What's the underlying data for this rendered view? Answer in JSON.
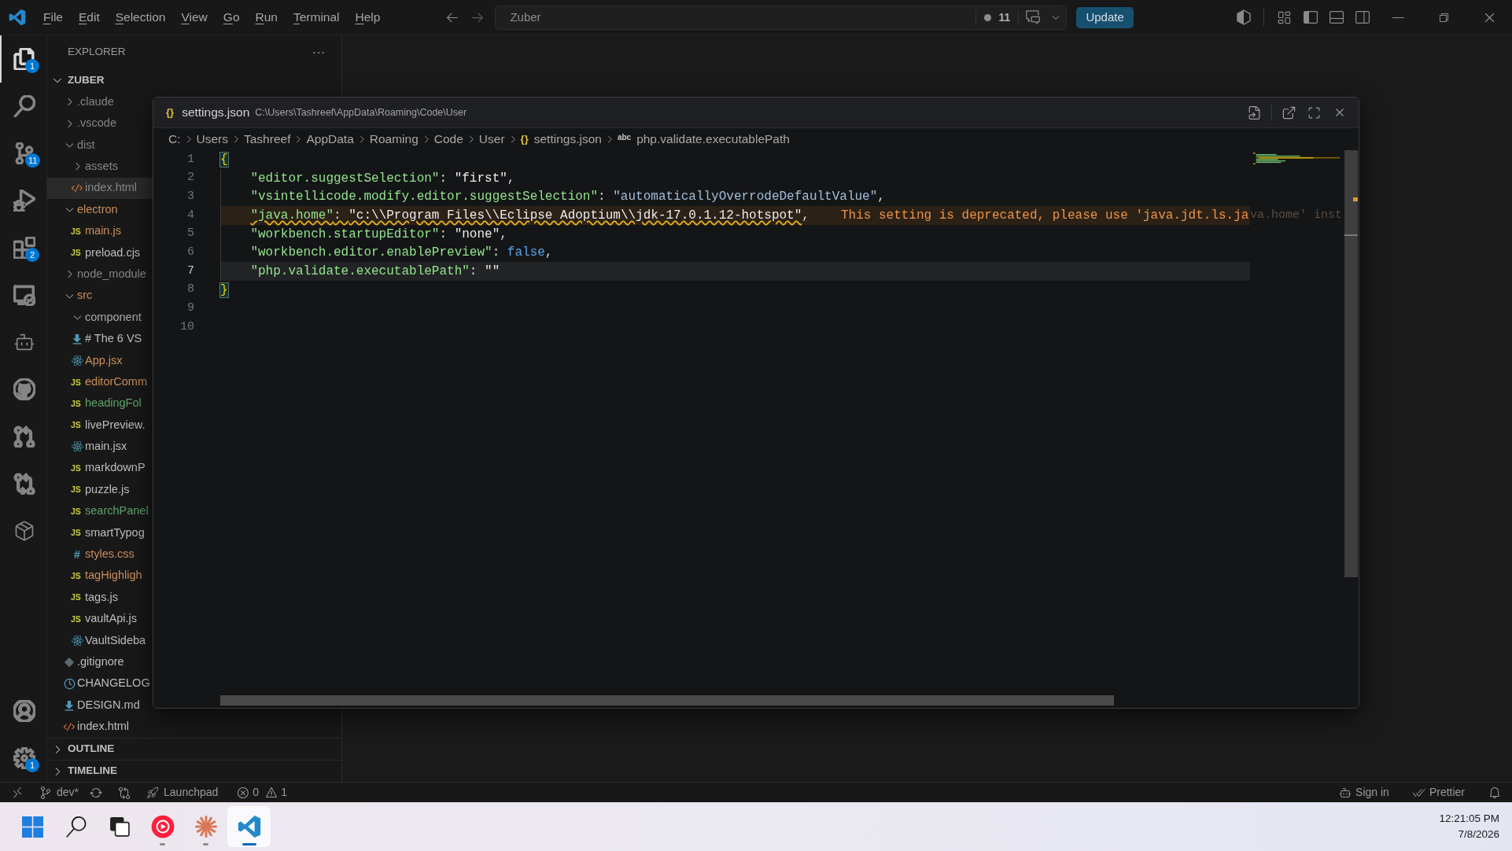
{
  "title_bar": {
    "menu": [
      {
        "label": "File"
      },
      {
        "label": "Edit"
      },
      {
        "label": "Selection"
      },
      {
        "label": "View"
      },
      {
        "label": "Go"
      },
      {
        "label": "Run"
      },
      {
        "label": "Terminal"
      },
      {
        "label": "Help"
      }
    ],
    "command_center": {
      "label": "Zuber",
      "count": "11"
    },
    "update_button": "Update",
    "layout_toggles": [
      {
        "kind": "primary_sidebar",
        "on": true
      },
      {
        "kind": "panel",
        "on": false
      },
      {
        "kind": "secondary_sidebar",
        "on": false
      }
    ]
  },
  "activity_bar": {
    "items": [
      {
        "kind": "explorer",
        "selected": true,
        "badge": "1"
      },
      {
        "kind": "search",
        "selected": false
      },
      {
        "kind": "source_control",
        "selected": false,
        "badge": "11"
      },
      {
        "kind": "run_debug",
        "selected": false
      },
      {
        "kind": "extensions",
        "selected": false,
        "badge": "2"
      },
      {
        "kind": "remote_explorer",
        "selected": false
      },
      {
        "kind": "copilot",
        "selected": false
      },
      {
        "kind": "github",
        "selected": false
      },
      {
        "kind": "pull_requests",
        "selected": false
      },
      {
        "kind": "compare",
        "selected": false
      },
      {
        "kind": "containers",
        "selected": false
      }
    ],
    "bottom": [
      {
        "kind": "accounts"
      },
      {
        "kind": "manage",
        "badge": "1"
      }
    ]
  },
  "sidebar": {
    "title": "EXPLORER",
    "root": {
      "label": "ZUBER",
      "expanded": true
    },
    "tree": [
      {
        "label": ".claude",
        "kind": "folder",
        "expanded": false,
        "selected": false,
        "color": "#858585"
      },
      {
        "label": ".vscode",
        "kind": "folder",
        "expanded": false,
        "selected": false,
        "color": "#858585"
      },
      {
        "label": "dist",
        "kind": "folder",
        "expanded": true,
        "selected": false,
        "color": "#858585",
        "children": [
          {
            "label": "assets",
            "kind": "folder",
            "expanded": false,
            "selected": false,
            "color": "#858585"
          },
          {
            "label": "index.html",
            "kind": "html",
            "selected": true,
            "color": "#858585"
          }
        ]
      },
      {
        "label": "electron",
        "kind": "folder",
        "expanded": true,
        "selected": false,
        "color": "#c98f59",
        "children": [
          {
            "label": "main.js",
            "kind": "js",
            "icon_text": "JS",
            "selected": false,
            "color": "#c98f59"
          },
          {
            "label": "preload.cjs",
            "kind": "js",
            "icon_text": "JS",
            "selected": false,
            "color": "#bdbdbd"
          }
        ]
      },
      {
        "label": "node_module",
        "kind": "folder",
        "expanded": false,
        "selected": false,
        "color": "#858585"
      },
      {
        "label": "src",
        "kind": "folder",
        "expanded": true,
        "selected": false,
        "color": "#c98f59",
        "children": [
          {
            "label": "component",
            "kind": "folder",
            "expanded": true,
            "selected": false,
            "color": "#a9a9a9"
          },
          {
            "label": "# The 6 VS",
            "kind": "markdown",
            "selected": false,
            "color": "#bdbdbd"
          },
          {
            "label": "App.jsx",
            "kind": "react",
            "selected": false,
            "color": "#c98f59"
          },
          {
            "label": "editorComm",
            "kind": "js",
            "icon_text": "JS",
            "selected": false,
            "color": "#c98f59"
          },
          {
            "label": "headingFol",
            "kind": "js",
            "icon_text": "JS",
            "selected": false,
            "color": "#5da36a"
          },
          {
            "label": "livePreview.",
            "kind": "js",
            "icon_text": "JS",
            "selected": false,
            "color": "#bdbdbd"
          },
          {
            "label": "main.jsx",
            "kind": "react",
            "selected": false,
            "color": "#bdbdbd"
          },
          {
            "label": "markdownP",
            "kind": "js",
            "icon_text": "JS",
            "selected": false,
            "color": "#bdbdbd"
          },
          {
            "label": "puzzle.js",
            "kind": "js",
            "icon_text": "JS",
            "selected": false,
            "color": "#bdbdbd"
          },
          {
            "label": "searchPanel",
            "kind": "js",
            "icon_text": "JS",
            "selected": false,
            "color": "#5da36a"
          },
          {
            "label": "smartTypog",
            "kind": "js",
            "icon_text": "JS",
            "selected": false,
            "color": "#bdbdbd"
          },
          {
            "label": "styles.css",
            "kind": "css",
            "icon_text": "#",
            "selected": false,
            "color": "#c98f59"
          },
          {
            "label": "tagHighligh",
            "kind": "js",
            "icon_text": "JS",
            "selected": false,
            "color": "#c98f59"
          },
          {
            "label": "tags.js",
            "kind": "js",
            "icon_text": "JS",
            "selected": false,
            "color": "#bdbdbd"
          },
          {
            "label": "vaultApi.js",
            "kind": "js",
            "icon_text": "JS",
            "selected": false,
            "color": "#bdbdbd"
          },
          {
            "label": "VaultSideba",
            "kind": "react",
            "selected": false,
            "color": "#bdbdbd"
          }
        ]
      },
      {
        "label": ".gitignore",
        "kind": "git",
        "selected": false,
        "color": "#bdbdbd"
      },
      {
        "label": "CHANGELOG",
        "kind": "changelog",
        "selected": false,
        "color": "#bdbdbd"
      },
      {
        "label": "DESIGN.md",
        "kind": "markdown",
        "selected": false,
        "color": "#bdbdbd"
      },
      {
        "label": "index.html",
        "kind": "html",
        "selected": false,
        "color": "#bdbdbd"
      }
    ],
    "sections": [
      {
        "label": "OUTLINE",
        "expanded": false
      },
      {
        "label": "TIMELINE",
        "expanded": false
      }
    ]
  },
  "editor_window": {
    "tab": {
      "icon_text": "{}",
      "title": "settings.json",
      "path": "C:\\Users\\Tashreef\\AppData\\Roaming\\Code\\User"
    },
    "breadcrumbs": [
      {
        "label": "C:"
      },
      {
        "label": "Users"
      },
      {
        "label": "Tashreef"
      },
      {
        "label": "AppData"
      },
      {
        "label": "Roaming"
      },
      {
        "label": "Code"
      },
      {
        "label": "User"
      },
      {
        "label": "settings.json",
        "icon_text": "{}"
      },
      {
        "label": "php.validate.executablePath",
        "icon_text": "abc"
      }
    ],
    "lines": [
      {
        "number": "1",
        "indented": false,
        "warning": false,
        "current": false,
        "tokens": [
          {
            "kind": "bracket",
            "text": "{",
            "matched": true
          }
        ]
      },
      {
        "number": "2",
        "indented": true,
        "warning": false,
        "current": false,
        "tokens": [
          {
            "kind": "key",
            "text": "\"editor.suggestSelection\"",
            "squiggle": false
          },
          {
            "kind": "punct",
            "text": ": ",
            "squiggle": false
          },
          {
            "kind": "string",
            "text": "\"first\"",
            "squiggle": false
          },
          {
            "kind": "punct",
            "text": ",",
            "squiggle": false
          }
        ]
      },
      {
        "number": "3",
        "indented": true,
        "warning": false,
        "current": false,
        "tokens": [
          {
            "kind": "key",
            "text": "\"vsintellicode.modify.editor.suggestSelection\"",
            "squiggle": false
          },
          {
            "kind": "punct",
            "text": ": ",
            "squiggle": false
          },
          {
            "kind": "enum_value",
            "text": "\"automaticallyOverrodeDefaultValue\"",
            "squiggle": false
          },
          {
            "kind": "punct",
            "text": ",",
            "squiggle": false
          }
        ]
      },
      {
        "number": "4",
        "indented": true,
        "warning": true,
        "current": false,
        "tokens": [
          {
            "kind": "key",
            "text": "\"java.home\"",
            "squiggle": true
          },
          {
            "kind": "punct",
            "text": ": ",
            "squiggle": true
          },
          {
            "kind": "string",
            "text": "\"c:\\\\Program Files\\\\Eclipse Adoptium\\\\jdk-17.0.1.12-hotspot\"",
            "squiggle": true
          },
          {
            "kind": "punct",
            "text": ",",
            "squiggle": false
          }
        ],
        "hint": {
          "text": "This setting is deprecated, please use 'java.jdt.ls.ja",
          "faded": "va.home' inst"
        }
      },
      {
        "number": "5",
        "indented": true,
        "warning": false,
        "current": false,
        "tokens": [
          {
            "kind": "key",
            "text": "\"workbench.startupEditor\"",
            "squiggle": false
          },
          {
            "kind": "punct",
            "text": ": ",
            "squiggle": false
          },
          {
            "kind": "string",
            "text": "\"none\"",
            "squiggle": false
          },
          {
            "kind": "punct",
            "text": ",",
            "squiggle": false
          }
        ]
      },
      {
        "number": "6",
        "indented": true,
        "warning": false,
        "current": false,
        "tokens": [
          {
            "kind": "key",
            "text": "\"workbench.editor.enablePreview\"",
            "squiggle": false
          },
          {
            "kind": "punct",
            "text": ": ",
            "squiggle": false
          },
          {
            "kind": "boolean",
            "text": "false",
            "squiggle": false
          },
          {
            "kind": "punct",
            "text": ",",
            "squiggle": false
          }
        ]
      },
      {
        "number": "7",
        "indented": true,
        "warning": false,
        "current": true,
        "tokens": [
          {
            "kind": "key",
            "text": "\"php.validate.executablePath\"",
            "squiggle": false
          },
          {
            "kind": "punct",
            "text": ": ",
            "squiggle": false
          },
          {
            "kind": "string",
            "text": "\"\"",
            "squiggle": false
          }
        ]
      },
      {
        "number": "8",
        "indented": false,
        "warning": false,
        "current": false,
        "tokens": [
          {
            "kind": "bracket",
            "text": "}",
            "matched": true
          }
        ]
      },
      {
        "number": "9",
        "indented": false,
        "warning": false,
        "current": false
      },
      {
        "number": "10",
        "indented": false,
        "warning": false,
        "current": false
      }
    ]
  },
  "status_bar": {
    "branch": "dev*",
    "launchpad": "Launchpad",
    "errors": "0",
    "warnings": "1",
    "sign_in": "Sign in",
    "formatter": "Prettier"
  },
  "taskbar": {
    "apps": [
      {
        "kind": "music",
        "running": true,
        "active": false
      },
      {
        "kind": "assistant",
        "running": true,
        "active": false
      },
      {
        "kind": "code_editor",
        "running": true,
        "active": true
      }
    ],
    "clock": {
      "time": "12:21:05 PM",
      "date": "7/8/2026"
    }
  }
}
